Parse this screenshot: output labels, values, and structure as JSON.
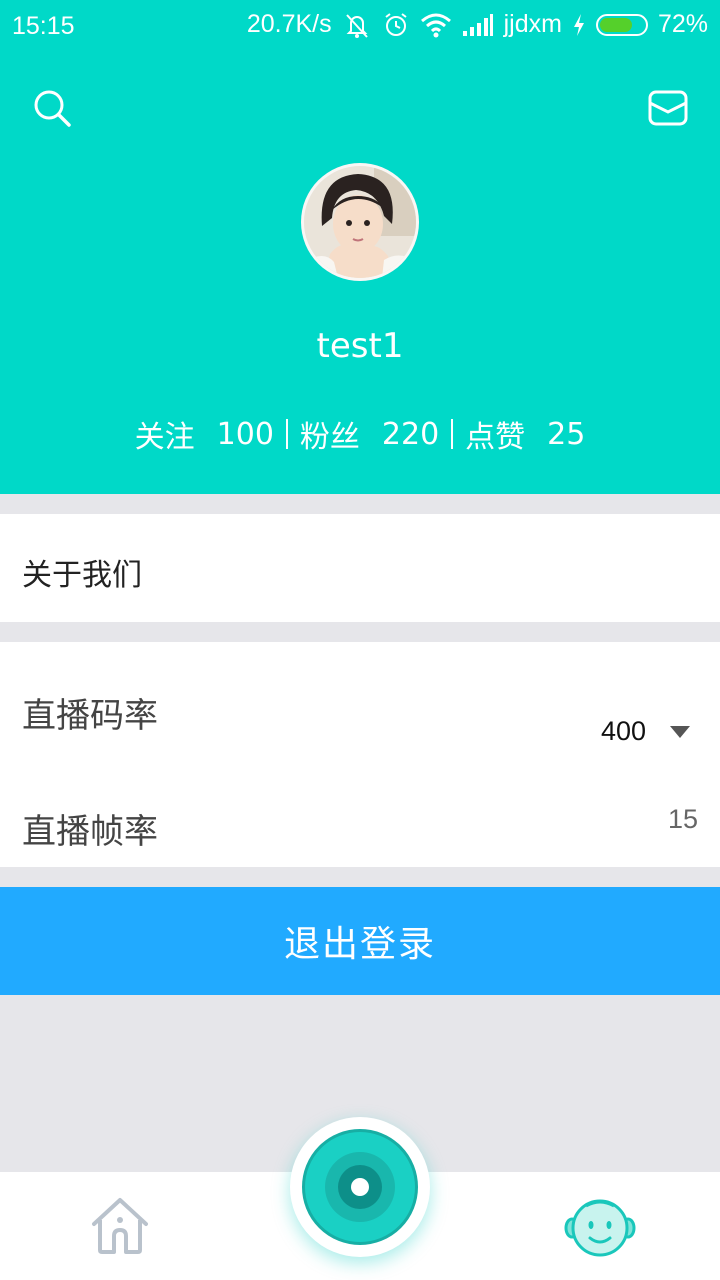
{
  "status_bar": {
    "time": "15:15",
    "net_speed": "20.7K/s",
    "carrier": "jjdxm",
    "battery": "72%",
    "battery_level": 0.72
  },
  "header": {
    "username": "test1",
    "stats": [
      {
        "label": "关注",
        "value": "100"
      },
      {
        "label": "粉丝",
        "value": "220"
      },
      {
        "label": "点赞",
        "value": "25"
      }
    ]
  },
  "menu": {
    "about": "关于我们"
  },
  "settings": {
    "bitrate_label": "直播码率",
    "bitrate_value": "400",
    "framerate_label": "直播帧率",
    "framerate_value": "15"
  },
  "logout_label": "退出登录",
  "colors": {
    "primary": "#00d9c8",
    "logout": "#21aaff",
    "background": "#e6e6ea"
  },
  "icons": [
    "search-icon",
    "mail-icon",
    "home-icon",
    "live-icon",
    "profile-icon"
  ]
}
